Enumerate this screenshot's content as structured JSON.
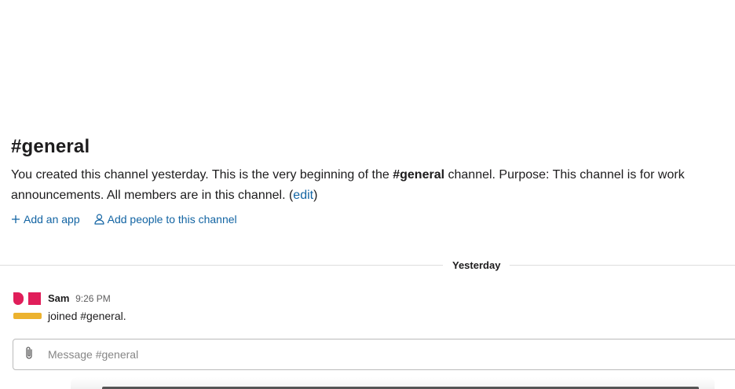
{
  "channel": {
    "title": "#general",
    "description_start": "You created this channel yesterday. This is the very beginning of the ",
    "description_channel": "#general",
    "description_mid": " channel. Purpose: This channel is for work",
    "description_line2": "announcements. All members are in this channel. (",
    "edit_label": "edit",
    "description_end": ")",
    "add_app_label": "Add an app",
    "add_people_label": "Add people to this channel"
  },
  "divider": {
    "label": "Yesterday"
  },
  "messages": [
    {
      "sender": "Sam",
      "time": "9:26 PM",
      "text": "joined #general."
    }
  ],
  "composer": {
    "placeholder": "Message #general"
  },
  "colors": {
    "link": "#1264a3",
    "avatar_red": "#e01e5a",
    "avatar_yellow": "#ecb22e"
  },
  "icons": {
    "add_app": "plus-icon",
    "add_people": "person-icon",
    "attach": "paperclip-icon"
  }
}
